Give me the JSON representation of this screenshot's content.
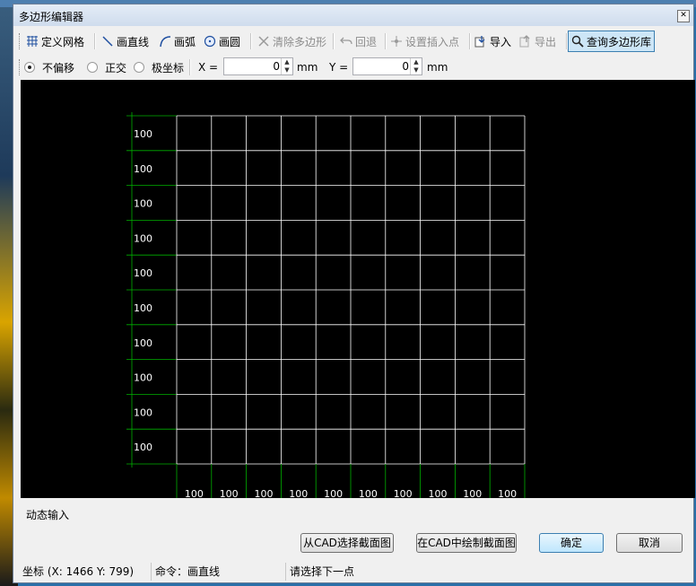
{
  "window": {
    "title": "多边形编辑器"
  },
  "toolbar": {
    "define_grid": "定义网格",
    "draw_line": "画直线",
    "draw_arc": "画弧",
    "draw_circle": "画圆",
    "clear_polygon": "清除多边形",
    "undo": "回退",
    "set_insert_point": "设置插入点",
    "import": "导入",
    "export": "导出",
    "query_library": "查询多边形库"
  },
  "snap": {
    "options": [
      "不偏移",
      "正交",
      "极坐标"
    ],
    "selected": "不偏移",
    "x_label": "X =",
    "x_value": "0",
    "x_unit": "mm",
    "y_label": "Y =",
    "y_value": "0",
    "y_unit": "mm"
  },
  "grid": {
    "row_labels": [
      "100",
      "100",
      "100",
      "100",
      "100",
      "100",
      "100",
      "100",
      "100",
      "100"
    ],
    "col_labels": [
      "100",
      "100",
      "100",
      "100",
      "100",
      "100",
      "100",
      "100",
      "100",
      "100"
    ],
    "line_color": "#ffffff",
    "dim_color": "#00b000"
  },
  "dynamic_input": "动态输入",
  "buttons": {
    "select_from_cad": "从CAD选择截面图",
    "draw_in_cad": "在CAD中绘制截面图",
    "ok": "确定",
    "cancel": "取消"
  },
  "status": {
    "coords": "坐标 (X: 1466 Y: 799)",
    "command": "命令：画直线",
    "prompt": "请选择下一点"
  }
}
